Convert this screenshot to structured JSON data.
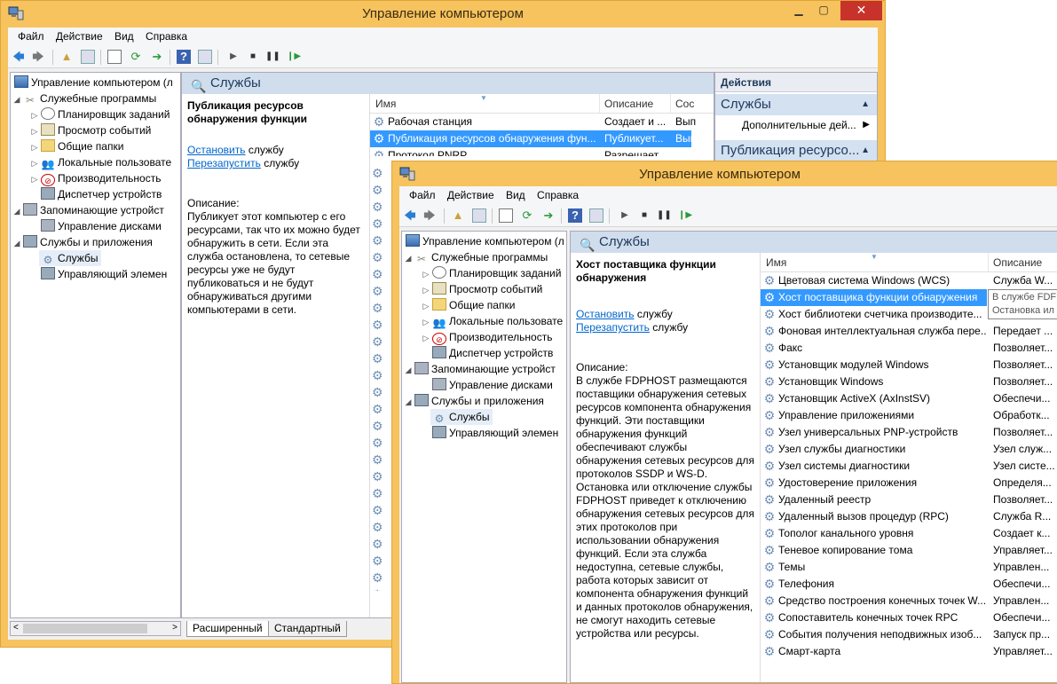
{
  "colors": {
    "accent": "#f6c35e",
    "selection": "#3399ff",
    "close": "#c7332a"
  },
  "back": {
    "title": "Управление компьютером",
    "menu": [
      "Файл",
      "Действие",
      "Вид",
      "Справка"
    ],
    "tree": [
      {
        "label": "Управление компьютером (л",
        "icon": "computer-icon"
      },
      {
        "label": "Служебные программы",
        "icon": "tools-icon"
      },
      {
        "label": "Планировщик заданий",
        "icon": "clock-icon"
      },
      {
        "label": "Просмотр событий",
        "icon": "event-viewer-icon"
      },
      {
        "label": "Общие папки",
        "icon": "folder-icon"
      },
      {
        "label": "Локальные пользовате",
        "icon": "users-icon"
      },
      {
        "label": "Производительность",
        "icon": "performance-icon"
      },
      {
        "label": "Диспетчер устройств",
        "icon": "device-manager-icon"
      },
      {
        "label": "Запоминающие устройст",
        "icon": "storage-icon"
      },
      {
        "label": "Управление дисками",
        "icon": "disk-icon"
      },
      {
        "label": "Службы и приложения",
        "icon": "services-apps-icon"
      },
      {
        "label": "Службы",
        "icon": "services-icon"
      },
      {
        "label": "Управляющий элемен",
        "icon": "wmi-icon"
      }
    ],
    "header": "Службы",
    "desc": {
      "title": "Публикация ресурсов обнаружения функции",
      "stop": "Остановить",
      "restart": "Перезапустить",
      "suffix": "службу",
      "label": "Описание:",
      "text": "Публикует этот компьютер с его ресурсами, так что их можно будет обнаружить в сети.  Если эта служба остановлена, то сетевые ресурсы уже не будут публиковаться и не будут обнаруживаться другими компьютерами в сети."
    },
    "columns": {
      "name": "Имя",
      "desc": "Описание",
      "status": "Сос"
    },
    "rows": [
      {
        "name": "Рабочая станция",
        "desc": "Создает и ...",
        "status": "Вып"
      },
      {
        "name": "Публикация ресурсов обнаружения фун...",
        "desc": "Публикует...",
        "status": "Вып"
      },
      {
        "name": "Протокол PNRP",
        "desc": "Разрешает...",
        "status": ""
      }
    ],
    "tabs": [
      "Расширенный",
      "Стандартный"
    ],
    "actions": {
      "header": "Действия",
      "section1": "Службы",
      "item1": "Дополнительные дей...",
      "section2": "Публикация ресурсо..."
    }
  },
  "front": {
    "title": "Управление компьютером",
    "menu": [
      "Файл",
      "Действие",
      "Вид",
      "Справка"
    ],
    "tree": [
      {
        "label": "Управление компьютером (л",
        "icon": "computer-icon"
      },
      {
        "label": "Служебные программы",
        "icon": "tools-icon"
      },
      {
        "label": "Планировщик заданий",
        "icon": "clock-icon"
      },
      {
        "label": "Просмотр событий",
        "icon": "event-viewer-icon"
      },
      {
        "label": "Общие папки",
        "icon": "folder-icon"
      },
      {
        "label": "Локальные пользовате",
        "icon": "users-icon"
      },
      {
        "label": "Производительность",
        "icon": "performance-icon"
      },
      {
        "label": "Диспетчер устройств",
        "icon": "device-manager-icon"
      },
      {
        "label": "Запоминающие устройст",
        "icon": "storage-icon"
      },
      {
        "label": "Управление дисками",
        "icon": "disk-icon"
      },
      {
        "label": "Службы и приложения",
        "icon": "services-apps-icon"
      },
      {
        "label": "Службы",
        "icon": "services-icon"
      },
      {
        "label": "Управляющий элемен",
        "icon": "wmi-icon"
      }
    ],
    "header": "Службы",
    "desc": {
      "title": "Хост поставщика функции обнаружения",
      "stop": "Остановить",
      "restart": "Перезапустить",
      "suffix": "службу",
      "label": "Описание:",
      "text": "В службе FDPHOST размещаются поставщики обнаружения сетевых ресурсов компонента обнаружения функций. Эти поставщики обнаружения функций обеспечивают службы обнаружения сетевых ресурсов для протоколов SSDP и WS-D. Остановка или отключение службы FDPHOST приведет к отключению обнаружения сетевых ресурсов для этих протоколов при использовании обнаружения функций. Если эта служба недоступна, сетевые службы, работа которых зависит от компонента обнаружения функций и данных протоколов обнаружения, не смогут находить сетевые устройства или ресурсы."
    },
    "columns": {
      "name": "Имя",
      "desc": "Описание"
    },
    "tooltip": [
      "В службе FDF",
      "Остановка ил"
    ],
    "rows": [
      {
        "name": "Цветовая система Windows (WCS)",
        "desc": "Служба W..."
      },
      {
        "name": "Хост поставщика функции обнаружения",
        "desc": ""
      },
      {
        "name": "Хост библиотеки счетчика производите...",
        "desc": ""
      },
      {
        "name": "Фоновая интеллектуальная служба пере...",
        "desc": "Передает ..."
      },
      {
        "name": "Факс",
        "desc": "Позволяет..."
      },
      {
        "name": "Установщик модулей Windows",
        "desc": "Позволяет..."
      },
      {
        "name": "Установщик Windows",
        "desc": "Позволяет..."
      },
      {
        "name": "Установщик ActiveX (AxInstSV)",
        "desc": "Обеспечи..."
      },
      {
        "name": "Управление приложениями",
        "desc": "Обработк..."
      },
      {
        "name": "Узел универсальных PNP-устройств",
        "desc": "Позволяет..."
      },
      {
        "name": "Узел службы диагностики",
        "desc": "Узел служ..."
      },
      {
        "name": "Узел системы диагностики",
        "desc": "Узел систе..."
      },
      {
        "name": "Удостоверение приложения",
        "desc": "Определя..."
      },
      {
        "name": "Удаленный реестр",
        "desc": "Позволяет..."
      },
      {
        "name": "Удаленный вызов процедур (RPC)",
        "desc": "Служба R..."
      },
      {
        "name": "Тополог канального уровня",
        "desc": "Создает к..."
      },
      {
        "name": "Теневое копирование тома",
        "desc": "Управляет..."
      },
      {
        "name": "Темы",
        "desc": "Управлен..."
      },
      {
        "name": "Телефония",
        "desc": "Обеспечи..."
      },
      {
        "name": "Средство построения конечных точек W...",
        "desc": "Управлен..."
      },
      {
        "name": "Сопоставитель конечных точек RPC",
        "desc": "Обеспечи..."
      },
      {
        "name": "События получения неподвижных изоб...",
        "desc": "Запуск пр..."
      },
      {
        "name": "Смарт-карта",
        "desc": "Управляет..."
      }
    ]
  }
}
